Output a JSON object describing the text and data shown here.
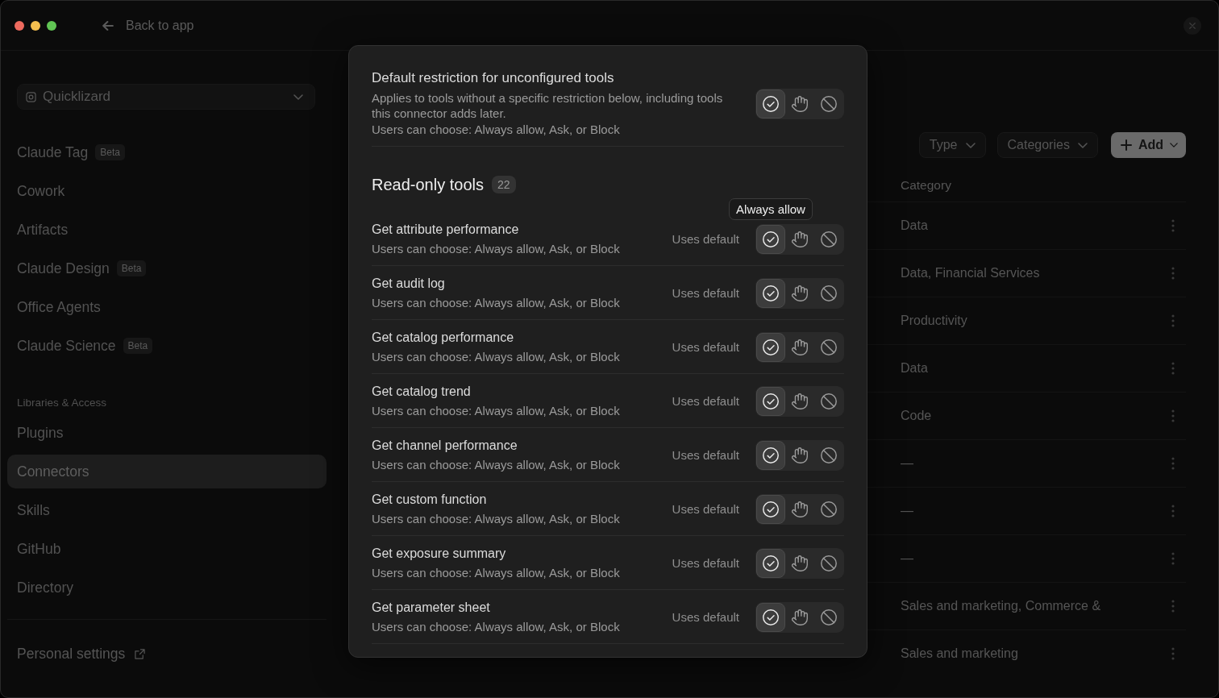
{
  "window": {
    "back_link": "Back to app"
  },
  "sidebar": {
    "workspace": "Quicklizard",
    "groups": [
      {
        "items": [
          {
            "label": "Claude Tag",
            "badge": "Beta",
            "selected": false
          },
          {
            "label": "Cowork",
            "selected": false
          },
          {
            "label": "Artifacts",
            "selected": false
          },
          {
            "label": "Claude Design",
            "badge": "Beta",
            "selected": false
          },
          {
            "label": "Office Agents",
            "selected": false
          },
          {
            "label": "Claude Science",
            "badge": "Beta",
            "selected": false
          }
        ]
      },
      {
        "heading": "Libraries & Access",
        "items": [
          {
            "label": "Plugins",
            "selected": false
          },
          {
            "label": "Connectors",
            "selected": true
          },
          {
            "label": "Skills",
            "selected": false
          },
          {
            "label": "GitHub",
            "selected": false
          },
          {
            "label": "Directory",
            "selected": false
          }
        ]
      }
    ],
    "footer_link": "Personal settings"
  },
  "main": {
    "filters": [
      "Type",
      "Categories"
    ],
    "add_button": "Add",
    "table": {
      "columns": [
        "Category"
      ],
      "rows": [
        {
          "category": "Data"
        },
        {
          "category": "Data, Financial Services"
        },
        {
          "category": "Productivity"
        },
        {
          "category": "Data"
        },
        {
          "category": "Code"
        },
        {
          "category": "—"
        },
        {
          "category": "—"
        },
        {
          "category": "—"
        },
        {
          "category": "Sales and marketing, Commerce &"
        },
        {
          "category": "Sales and marketing"
        }
      ]
    }
  },
  "modal": {
    "default_restriction": {
      "title": "Default restriction for unconfigured tools",
      "description": "Applies to tools without a specific restriction below, including tools this connector adds later.",
      "hint": "Users can choose: Always allow, Ask, or Block",
      "options": [
        {
          "kind": "allow",
          "selected": true
        },
        {
          "kind": "ask",
          "selected": false
        },
        {
          "kind": "block",
          "selected": false
        }
      ]
    },
    "section": {
      "title": "Read-only tools",
      "count": "22"
    },
    "tools": [
      {
        "name": "Get attribute performance",
        "hint": "Users can choose: Always allow, Ask, or Block",
        "status": "Uses default",
        "tooltip": "Always allow",
        "options": [
          {
            "kind": "allow",
            "selected": true
          },
          {
            "kind": "ask",
            "selected": false
          },
          {
            "kind": "block",
            "selected": false
          }
        ]
      },
      {
        "name": "Get audit log",
        "hint": "Users can choose: Always allow, Ask, or Block",
        "status": "Uses default",
        "options": [
          {
            "kind": "allow",
            "selected": true
          },
          {
            "kind": "ask",
            "selected": false
          },
          {
            "kind": "block",
            "selected": false
          }
        ]
      },
      {
        "name": "Get catalog performance",
        "hint": "Users can choose: Always allow, Ask, or Block",
        "status": "Uses default",
        "options": [
          {
            "kind": "allow",
            "selected": true
          },
          {
            "kind": "ask",
            "selected": false
          },
          {
            "kind": "block",
            "selected": false
          }
        ]
      },
      {
        "name": "Get catalog trend",
        "hint": "Users can choose: Always allow, Ask, or Block",
        "status": "Uses default",
        "options": [
          {
            "kind": "allow",
            "selected": true
          },
          {
            "kind": "ask",
            "selected": false
          },
          {
            "kind": "block",
            "selected": false
          }
        ]
      },
      {
        "name": "Get channel performance",
        "hint": "Users can choose: Always allow, Ask, or Block",
        "status": "Uses default",
        "options": [
          {
            "kind": "allow",
            "selected": true
          },
          {
            "kind": "ask",
            "selected": false
          },
          {
            "kind": "block",
            "selected": false
          }
        ]
      },
      {
        "name": "Get custom function",
        "hint": "Users can choose: Always allow, Ask, or Block",
        "status": "Uses default",
        "options": [
          {
            "kind": "allow",
            "selected": true
          },
          {
            "kind": "ask",
            "selected": false
          },
          {
            "kind": "block",
            "selected": false
          }
        ]
      },
      {
        "name": "Get exposure summary",
        "hint": "Users can choose: Always allow, Ask, or Block",
        "status": "Uses default",
        "options": [
          {
            "kind": "allow",
            "selected": true
          },
          {
            "kind": "ask",
            "selected": false
          },
          {
            "kind": "block",
            "selected": false
          }
        ]
      },
      {
        "name": "Get parameter sheet",
        "hint": "Users can choose: Always allow, Ask, or Block",
        "status": "Uses default",
        "options": [
          {
            "kind": "allow",
            "selected": true
          },
          {
            "kind": "ask",
            "selected": false
          },
          {
            "kind": "block",
            "selected": false
          }
        ]
      }
    ]
  }
}
